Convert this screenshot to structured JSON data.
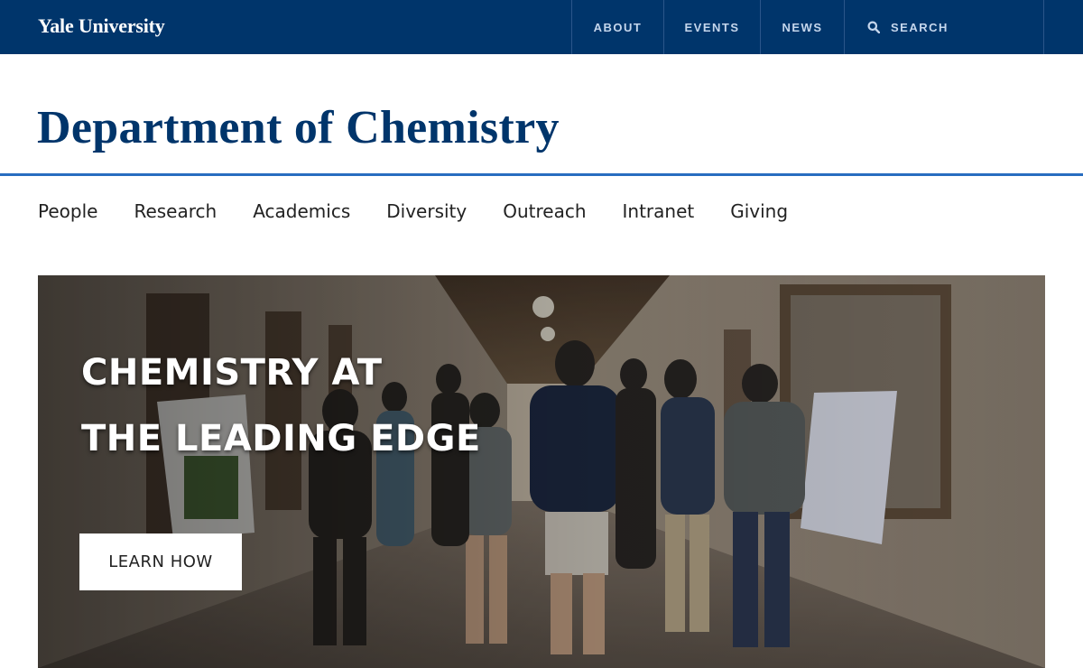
{
  "topbar": {
    "brand": "Yale University",
    "nav": [
      {
        "label": "ABOUT"
      },
      {
        "label": "EVENTS"
      },
      {
        "label": "NEWS"
      },
      {
        "label": "SEARCH",
        "icon": "search-icon"
      }
    ],
    "colors": {
      "background": "#00356b",
      "link": "#c5d6ec"
    }
  },
  "header": {
    "title": "Department of Chemistry",
    "accent": "#286dc0"
  },
  "main_nav": {
    "items": [
      "People",
      "Research",
      "Academics",
      "Diversity",
      "Outreach",
      "Intranet",
      "Giving"
    ]
  },
  "hero": {
    "title_line1": "CHEMISTRY AT",
    "title_line2": "THE LEADING EDGE",
    "button_label": "LEARN HOW",
    "image": "photo of students at a poster session in a stone corridor"
  }
}
